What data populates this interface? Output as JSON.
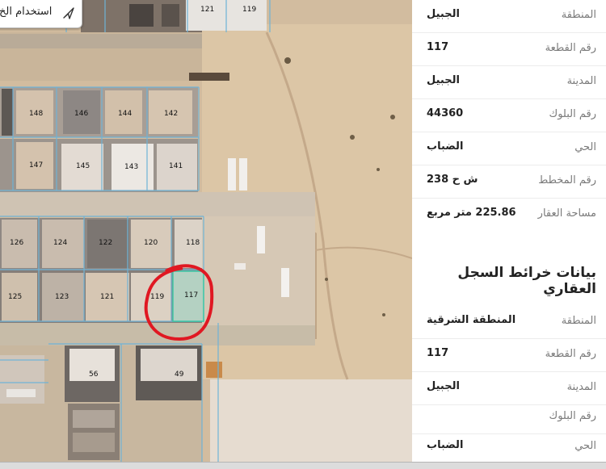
{
  "map": {
    "use_button_label": "استخدام الخ",
    "plots": [
      {
        "id": "p148",
        "label": "148"
      },
      {
        "id": "p146",
        "label": "146"
      },
      {
        "id": "p144",
        "label": "144"
      },
      {
        "id": "p142",
        "label": "142"
      },
      {
        "id": "p147",
        "label": "147"
      },
      {
        "id": "p145",
        "label": "145"
      },
      {
        "id": "p143",
        "label": "143"
      },
      {
        "id": "p141",
        "label": "141"
      },
      {
        "id": "p126",
        "label": "126"
      },
      {
        "id": "p124",
        "label": "124"
      },
      {
        "id": "p122",
        "label": "122"
      },
      {
        "id": "p120",
        "label": "120"
      },
      {
        "id": "p118",
        "label": "118"
      },
      {
        "id": "p125",
        "label": "125"
      },
      {
        "id": "p123",
        "label": "123"
      },
      {
        "id": "p121",
        "label": "121"
      },
      {
        "id": "p119",
        "label": "119"
      },
      {
        "id": "p117",
        "label": "117"
      },
      {
        "id": "p56",
        "label": "56"
      },
      {
        "id": "p49",
        "label": "49"
      },
      {
        "id": "top121",
        "label": "121"
      },
      {
        "id": "top119",
        "label": "119"
      }
    ],
    "highlight_color": "#e01822"
  },
  "info_top": [
    {
      "label": "المنطقة",
      "value": "الجبيل"
    },
    {
      "label": "رقم القطعة",
      "value": "117"
    },
    {
      "label": "المدينة",
      "value": "الجبيل"
    },
    {
      "label": "رقم البلوك",
      "value": "44360"
    },
    {
      "label": "الحي",
      "value": "الضباب"
    },
    {
      "label": "رقم المخطط",
      "value": "ش ح 238"
    },
    {
      "label": "مساحة العقار",
      "value": "225.86 متر مربع"
    }
  ],
  "section_title": "بيانات خرائط السجل العقاري",
  "info_bottom": [
    {
      "label": "المنطقة",
      "value": "المنطقة الشرقية"
    },
    {
      "label": "رقم القطعة",
      "value": "117"
    },
    {
      "label": "المدينة",
      "value": "الجبيل"
    },
    {
      "label": "رقم البلوك",
      "value": ""
    },
    {
      "label": "الحي",
      "value": "الضباب"
    }
  ]
}
